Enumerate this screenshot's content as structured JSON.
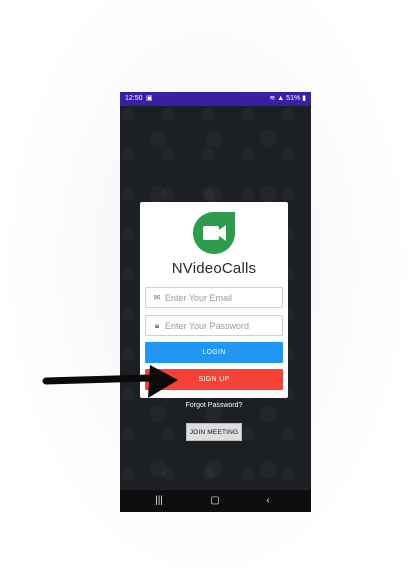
{
  "status_bar": {
    "time": "12:50",
    "notification_icon": "image-icon",
    "battery": "51%"
  },
  "app": {
    "name": "NVideoCalls",
    "logo_icon": "video-camera-icon",
    "logo_color": "#2e9b4f"
  },
  "form": {
    "email_placeholder": "Enter Your Email",
    "email_icon": "mail-icon",
    "password_placeholder": "Enter Your Password",
    "password_icon": "lock-icon",
    "login_label": "LOGIN",
    "signup_label": "SIGN UP",
    "forgot_label": "Forgot Password?",
    "join_label": "JOIN MEETING"
  },
  "colors": {
    "status_bar": "#3a1fa3",
    "login": "#2196f3",
    "signup": "#f44336"
  },
  "nav_bar": {
    "recent_icon": "recent-apps-icon",
    "home_icon": "home-icon",
    "back_icon": "back-icon"
  }
}
